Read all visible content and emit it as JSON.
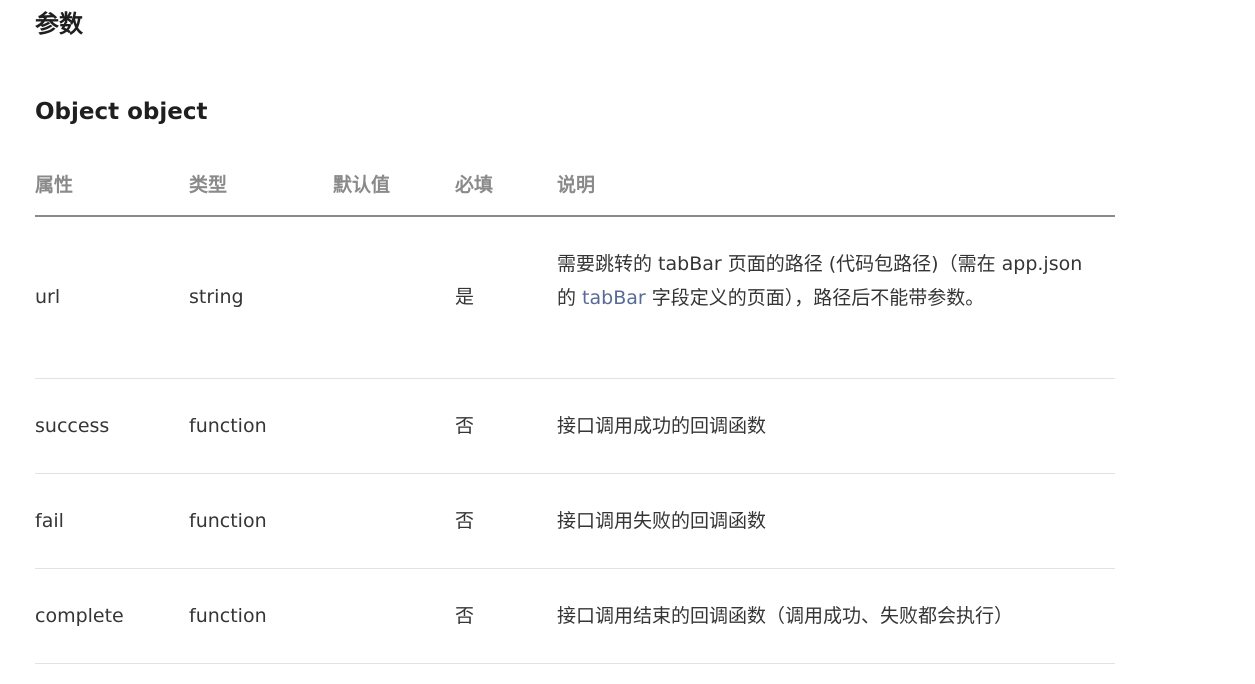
{
  "section": {
    "title": "参数"
  },
  "subsection": {
    "title": "Object object"
  },
  "table": {
    "headers": {
      "prop": "属性",
      "type": "类型",
      "default": "默认值",
      "required": "必填",
      "desc": "说明"
    },
    "rows": [
      {
        "prop": "url",
        "type": "string",
        "default": "",
        "required": "是",
        "desc_part1": "需要跳转的 tabBar 页面的路径 (代码包路径)（需在 app.json 的 ",
        "desc_link": "tabBar",
        "desc_part2": " 字段定义的页面），路径后不能带参数。"
      },
      {
        "prop": "success",
        "type": "function",
        "default": "",
        "required": "否",
        "desc": "接口调用成功的回调函数"
      },
      {
        "prop": "fail",
        "type": "function",
        "default": "",
        "required": "否",
        "desc": "接口调用失败的回调函数"
      },
      {
        "prop": "complete",
        "type": "function",
        "default": "",
        "required": "否",
        "desc": "接口调用结束的回调函数（调用成功、失败都会执行）"
      }
    ]
  },
  "colors": {
    "link": "#576b95",
    "header_text": "#8a8a8a",
    "body_text": "#353535",
    "row_divider": "#e2e2e2"
  }
}
